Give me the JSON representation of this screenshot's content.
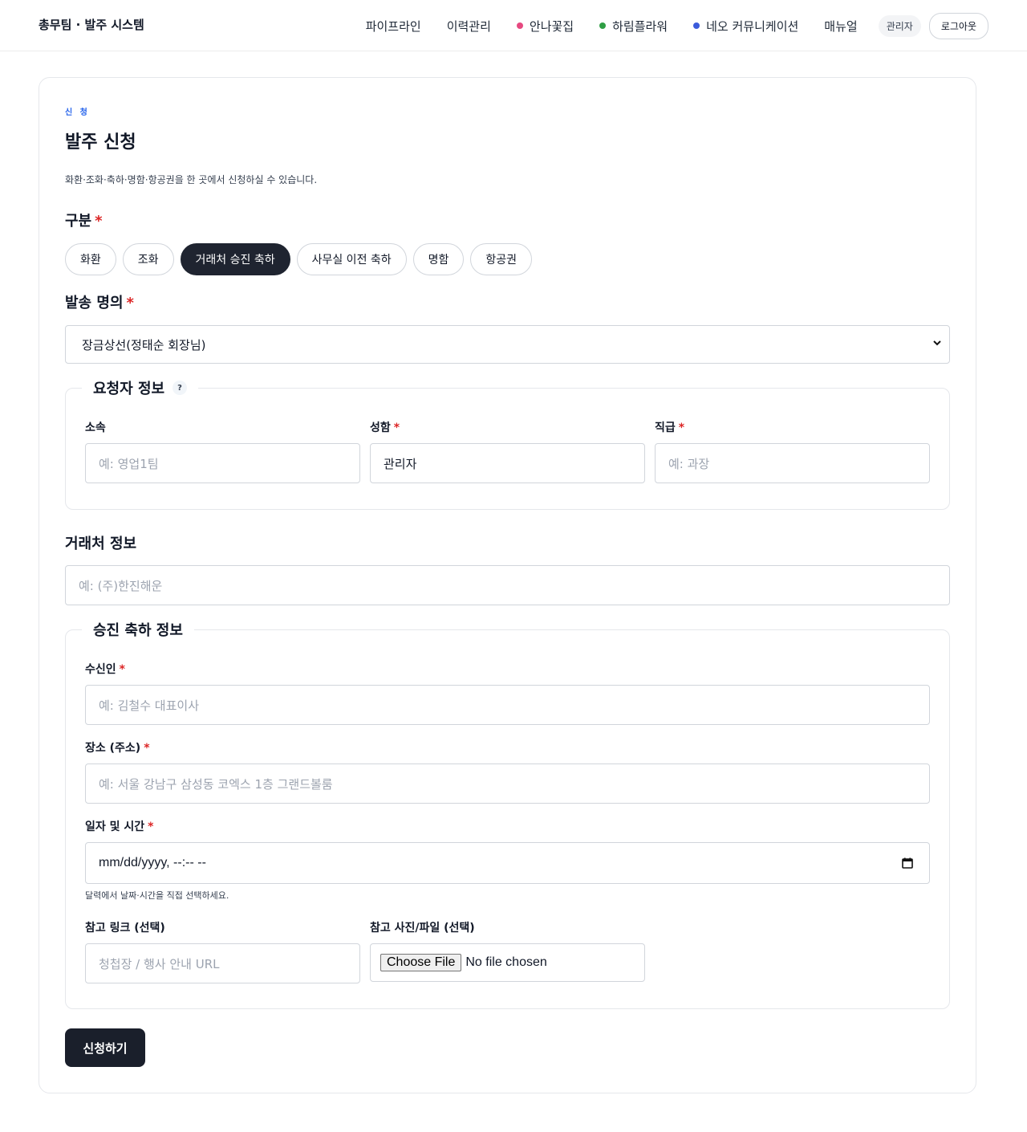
{
  "header": {
    "brand": "총무팀 · 발주 시스템",
    "nav": [
      {
        "label": "파이프라인"
      },
      {
        "label": "이력관리"
      },
      {
        "label": "안나꽃집",
        "dot_color": "#e64980"
      },
      {
        "label": "하림플라워",
        "dot_color": "#2f9e44"
      },
      {
        "label": "네오 커뮤니케이션",
        "dot_color": "#3b5bdb"
      },
      {
        "label": "매뉴얼"
      }
    ],
    "role_badge": "관리자",
    "logout_label": "로그아웃"
  },
  "page": {
    "eyebrow": "신 청",
    "title": "발주 신청",
    "description": "화환·조화·축하·명함·항공권을 한 곳에서 신청하실 수 있습니다."
  },
  "category": {
    "label": "구분",
    "required_mark": "*",
    "options": [
      "화환",
      "조화",
      "거래처 승진 축하",
      "사무실 이전 축하",
      "명함",
      "항공권"
    ],
    "selected": "거래처 승진 축하"
  },
  "sender": {
    "label": "발송 명의",
    "required_mark": "*",
    "value": "장금상선(정태순 회장님)"
  },
  "requester": {
    "legend": "요청자 정보",
    "help_icon": "?",
    "dept_label": "소속",
    "dept_placeholder": "예: 영업1팀",
    "name_label": "성함",
    "name_required": "*",
    "name_value": "관리자",
    "position_label": "직급",
    "position_required": "*",
    "position_placeholder": "예: 과장"
  },
  "client": {
    "label": "거래처 정보",
    "placeholder": "예: (주)한진해운"
  },
  "promotion": {
    "legend": "승진 축하 정보",
    "recipient_label": "수신인",
    "recipient_required": "*",
    "recipient_placeholder": "예: 김철수 대표이사",
    "place_label": "장소 (주소)",
    "place_required": "*",
    "place_placeholder": "예: 서울 강남구 삼성동 코엑스 1층 그랜드볼룸",
    "datetime_label": "일자 및 시간",
    "datetime_required": "*",
    "datetime_value": "mm/dd/yyyy, --:-- --",
    "datetime_hint": "달력에서 날짜·시간을 직접 선택하세요.",
    "link_label": "참고 링크 (선택)",
    "link_placeholder": "청첩장 / 행사 안내 URL",
    "file_label": "참고 사진/파일 (선택)",
    "file_button": "Choose File",
    "file_status": "No file chosen"
  },
  "submit_label": "신청하기",
  "colors": {
    "accent_dark": "#1f2430",
    "required": "#dc2626",
    "eyebrow": "#2563eb"
  }
}
